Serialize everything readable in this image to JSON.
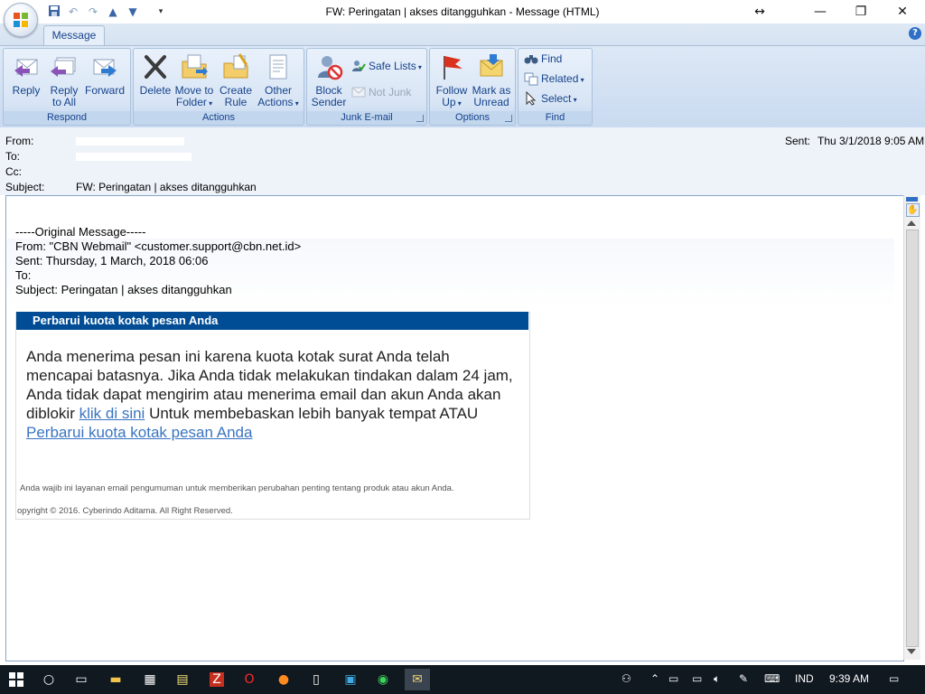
{
  "window": {
    "title": "FW: Peringatan | akses ditangguhkan - Message (HTML)"
  },
  "tabs": [
    {
      "label": "Message"
    }
  ],
  "ribbon": {
    "respond": {
      "label": "Respond",
      "reply": "Reply",
      "reply_all_1": "Reply",
      "reply_all_2": "to All",
      "forward": "Forward"
    },
    "actions": {
      "label": "Actions",
      "delete": "Delete",
      "move_1": "Move to",
      "move_2": "Folder",
      "create_1": "Create",
      "create_2": "Rule",
      "other_1": "Other",
      "other_2": "Actions"
    },
    "junk": {
      "label": "Junk E-mail",
      "block_1": "Block",
      "block_2": "Sender",
      "safe_lists": "Safe Lists",
      "not_junk": "Not Junk"
    },
    "options": {
      "label": "Options",
      "follow_1": "Follow",
      "follow_2": "Up",
      "mark_1": "Mark as",
      "mark_2": "Unread"
    },
    "find": {
      "label": "Find",
      "find": "Find",
      "related": "Related",
      "select": "Select"
    }
  },
  "header": {
    "from_label": "From:",
    "to_label": "To:",
    "cc_label": "Cc:",
    "subject_label": "Subject:",
    "subject": "FW: Peringatan | akses ditangguhkan",
    "sent_label": "Sent:",
    "sent": "Thu 3/1/2018 9:05 AM"
  },
  "message": {
    "original_marker": "-----Original Message-----",
    "from": "From: \"CBN Webmail\" <customer.support@cbn.net.id>",
    "sent": "Sent: Thursday, 1 March, 2018 06:06",
    "to": "To:",
    "subject": "Subject: Peringatan | akses ditangguhkan",
    "card_title": "Perbarui kuota kotak pesan Anda",
    "body_part1": "Anda menerima pesan ini karena kuota kotak surat Anda telah mencapai batasnya. Jika Anda tidak melakukan tindakan dalam 24 jam, Anda tidak dapat mengirim atau menerima email dan akun Anda akan diblokir ",
    "link1": "klik di sini",
    "body_part2": " Untuk membebaskan lebih banyak tempat ATAU ",
    "link2": "Perbarui kuota kotak pesan Anda",
    "notice": "Anda wajib ini layanan email pengumuman untuk memberikan perubahan penting tentang produk atau akun Anda.",
    "copyright": "opyright © 2016. Cyberindo Aditama. All Right Reserved."
  },
  "taskbar": {
    "language": "IND",
    "time": "9:39 AM"
  },
  "colors": {
    "card_header": "#004d95",
    "link": "#3a74c2",
    "ribbon_text": "#15428b",
    "taskbar": "#101820"
  }
}
